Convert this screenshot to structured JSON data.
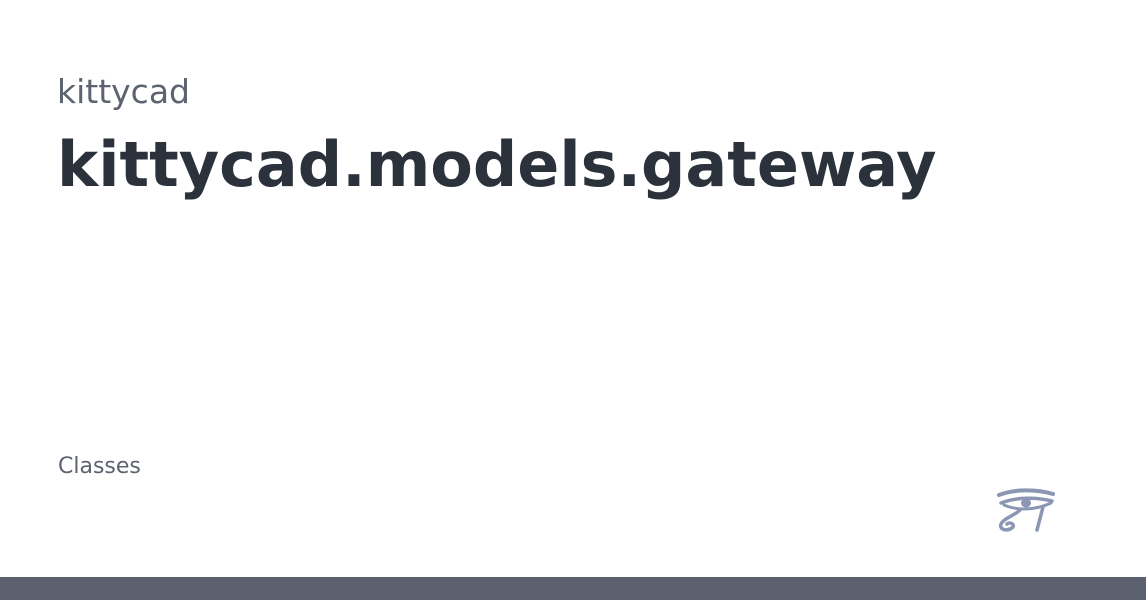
{
  "header": {
    "project_name": "kittycad",
    "module_title": "kittycad.models.gateway"
  },
  "body": {
    "section_label": "Classes"
  },
  "logo": {
    "icon": "eye-of-horus-icon",
    "color": "#8a96b4"
  },
  "footer": {
    "color": "#5b616e"
  }
}
